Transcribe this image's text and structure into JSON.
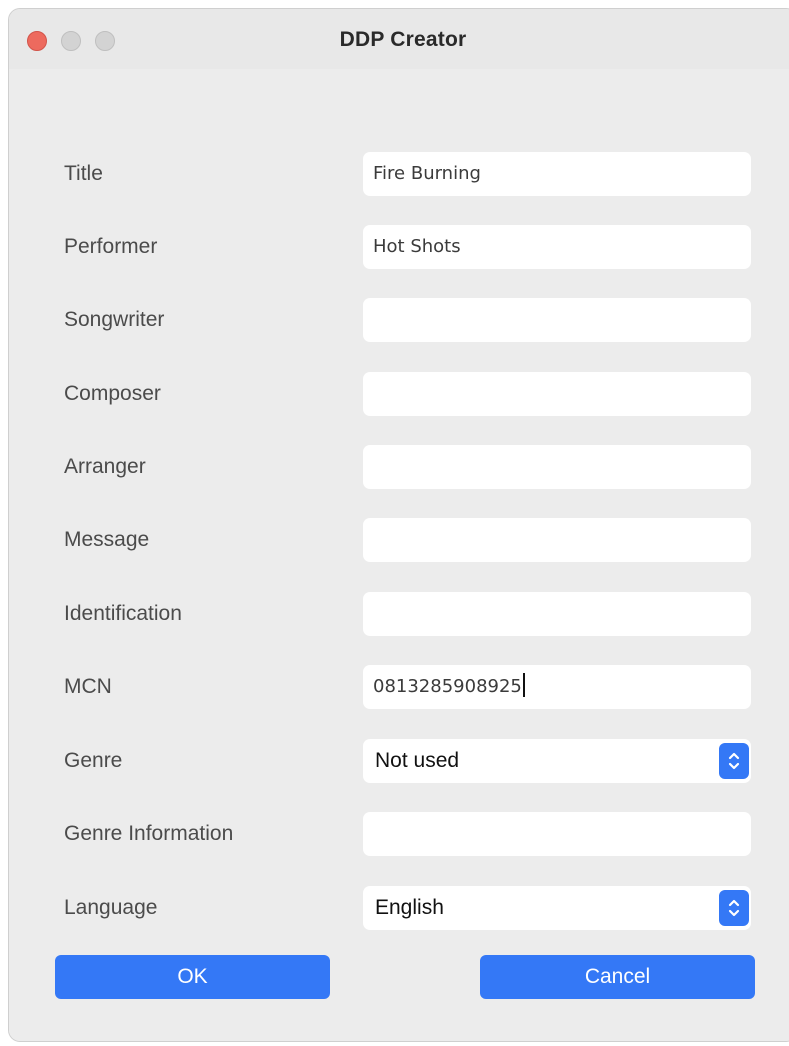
{
  "window": {
    "title": "DDP Creator"
  },
  "form": {
    "title": {
      "label": "Title",
      "value": "Fire Burning"
    },
    "performer": {
      "label": "Performer",
      "value": "Hot Shots"
    },
    "songwriter": {
      "label": "Songwriter",
      "value": ""
    },
    "composer": {
      "label": "Composer",
      "value": ""
    },
    "arranger": {
      "label": "Arranger",
      "value": ""
    },
    "message": {
      "label": "Message",
      "value": ""
    },
    "identification": {
      "label": "Identification",
      "value": ""
    },
    "mcn": {
      "label": "MCN",
      "value": "0813285908925"
    },
    "genre": {
      "label": "Genre",
      "selected": "Not used"
    },
    "genre_information": {
      "label": "Genre Information",
      "value": ""
    },
    "language": {
      "label": "Language",
      "selected": "English"
    }
  },
  "buttons": {
    "ok_label": "OK",
    "cancel_label": "Cancel"
  },
  "icons": {
    "select_arrows": "up-down-chevron-icon",
    "close": "close-dot",
    "minimize": "minimize-dot",
    "zoom": "zoom-dot"
  },
  "colors": {
    "accent": "#3478f6",
    "close": "#ed6a5e",
    "window_bg": "#ececec"
  }
}
